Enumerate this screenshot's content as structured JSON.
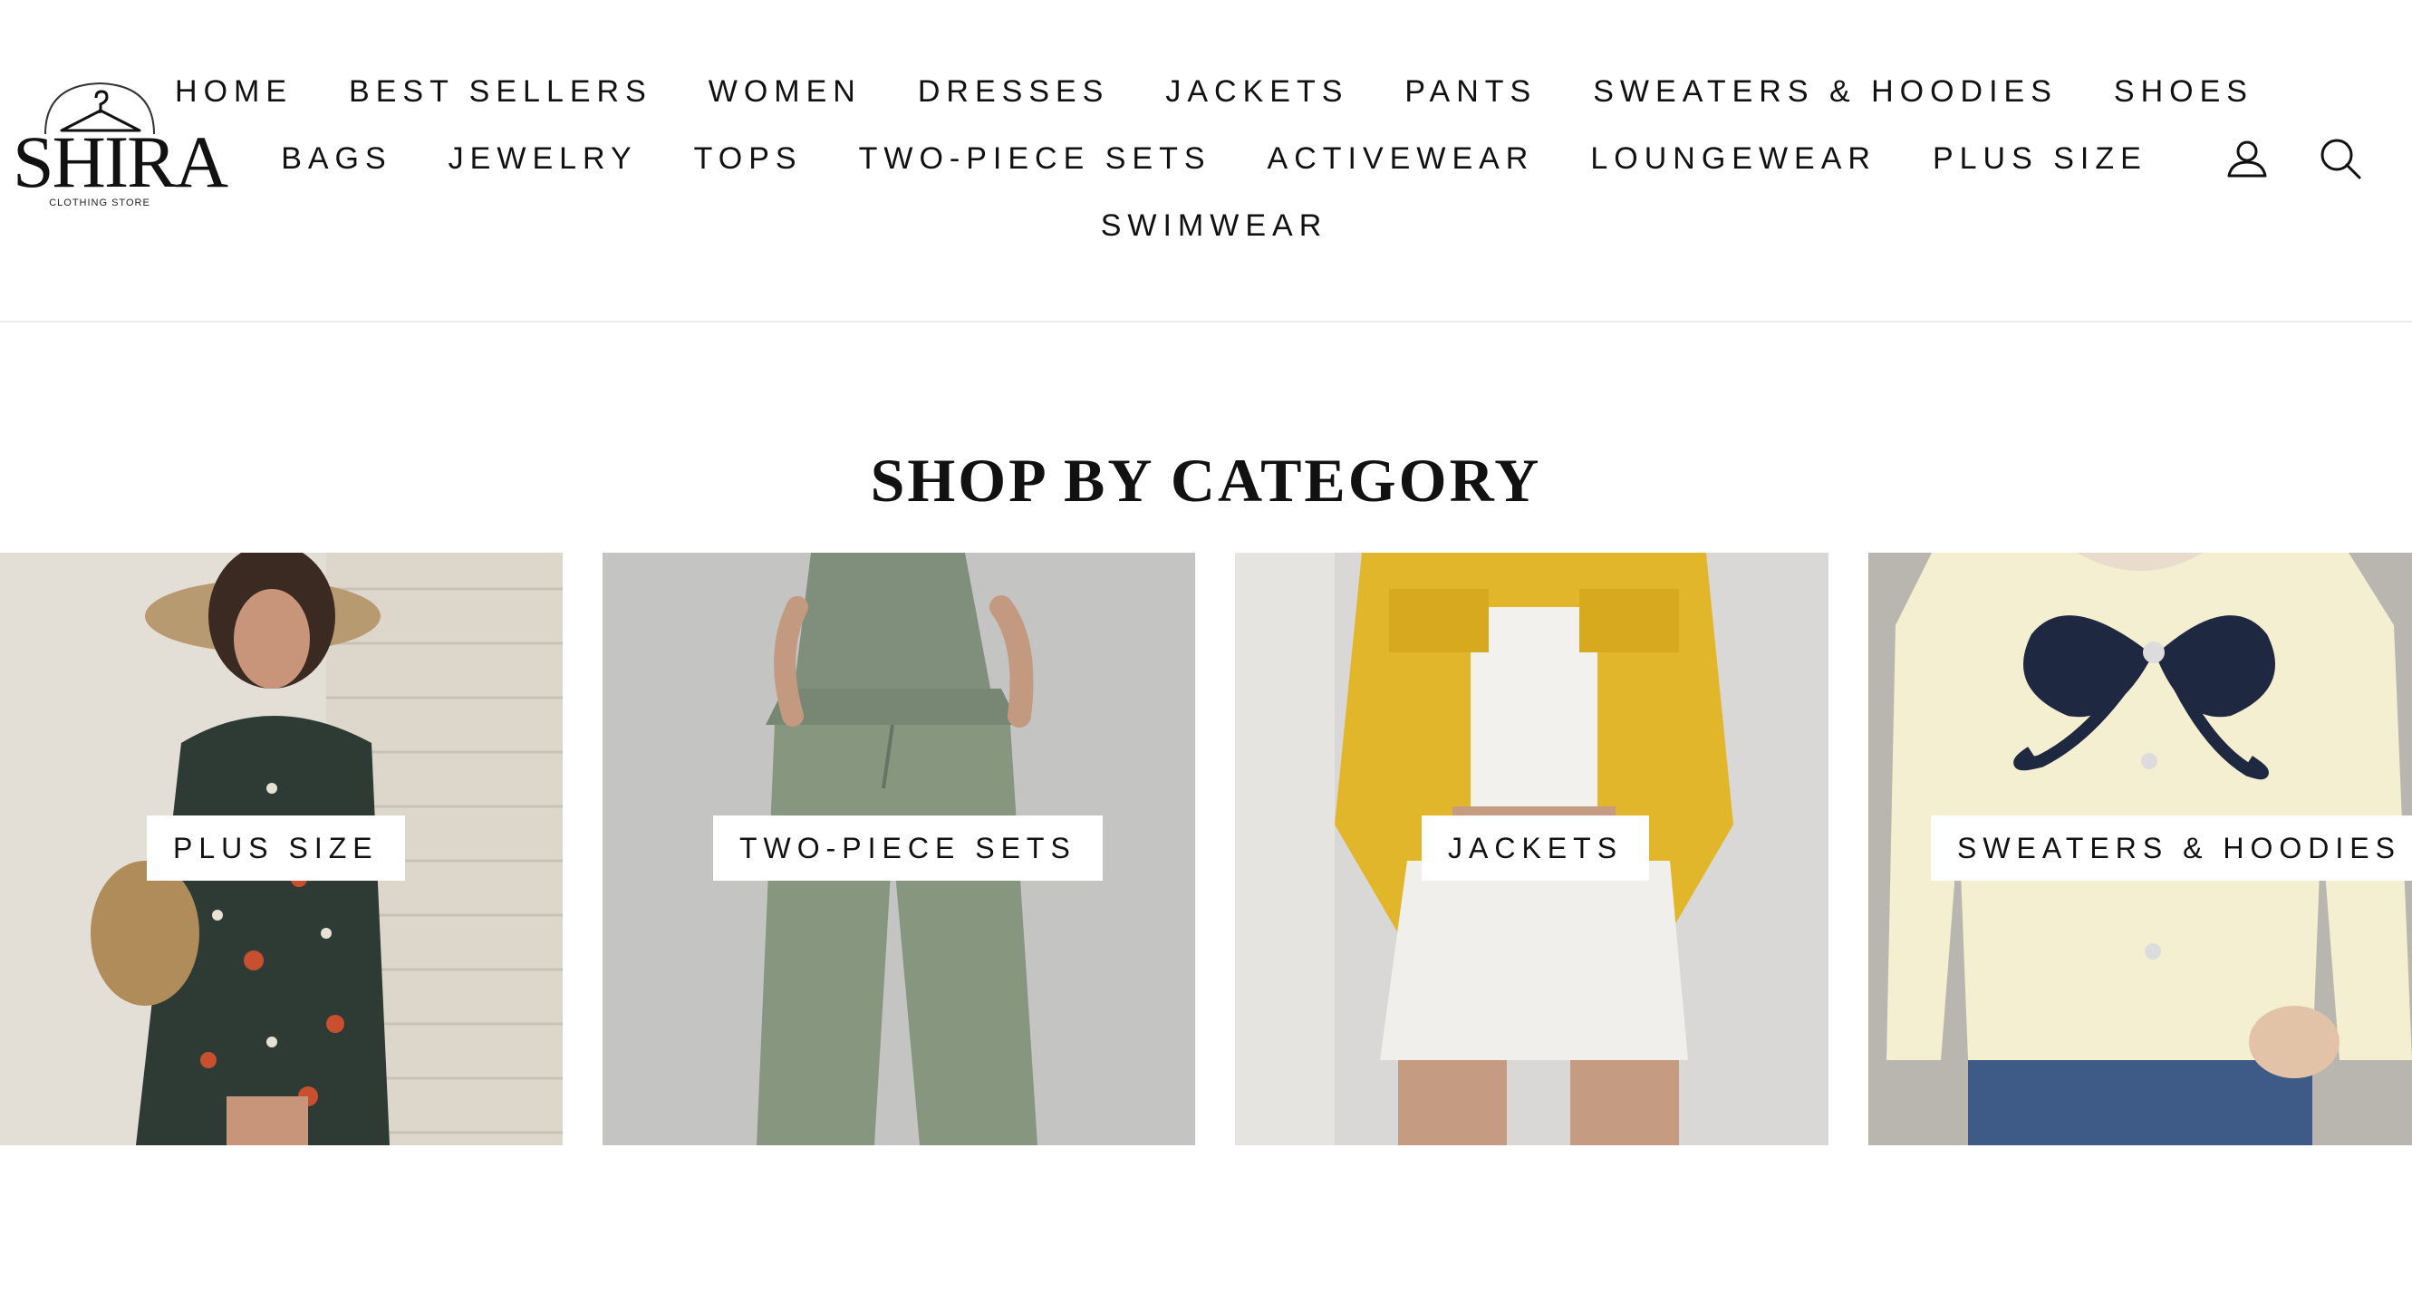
{
  "logo": {
    "wordmark": "SHIRA",
    "tagline": "CLOTHING STORE"
  },
  "nav": {
    "row1": [
      "HOME",
      "BEST SELLERS",
      "WOMEN",
      "DRESSES",
      "JACKETS",
      "PANTS",
      "SWEATERS & HOODIES",
      "SHOES"
    ],
    "row2": [
      "BAGS",
      "JEWELRY",
      "TOPS",
      "TWO-PIECE SETS",
      "ACTIVEWEAR",
      "LOUNGEWEAR",
      "PLUS SIZE"
    ],
    "row3": [
      "SWIMWEAR"
    ]
  },
  "header_icons": [
    "user-icon",
    "search-icon"
  ],
  "section": {
    "title": "SHOP BY CATEGORY"
  },
  "categories": [
    {
      "label": "PLUS SIZE",
      "image": "plus-size-image"
    },
    {
      "label": "TWO-PIECE SETS",
      "image": "two-piece-sets-image"
    },
    {
      "label": "JACKETS",
      "image": "jackets-image"
    },
    {
      "label": "SWEATERS & HOODIES",
      "image": "sweaters-hoodies-image"
    }
  ],
  "colors": {
    "text": "#111111",
    "background": "#ffffff",
    "divider": "#ececec"
  }
}
